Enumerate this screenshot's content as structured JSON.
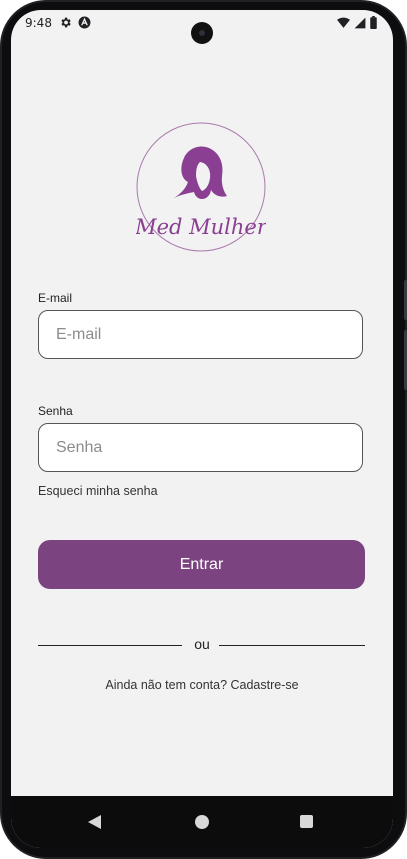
{
  "status_bar": {
    "time": "9:48",
    "left_icons": [
      "settings-gear-icon",
      "a-badge-icon"
    ],
    "right_icons": [
      "wifi-icon",
      "cellular-signal-icon",
      "battery-icon"
    ]
  },
  "logo": {
    "text": "Med Mulher",
    "color": "#8a3f92",
    "icon": "woman-silhouette-icon"
  },
  "form": {
    "email_label": "E-mail",
    "email_placeholder": "E-mail",
    "email_value": "",
    "password_label": "Senha",
    "password_placeholder": "Senha",
    "password_value": "",
    "forgot_password": "Esqueci minha senha",
    "submit_label": "Entrar",
    "divider_text": "ou",
    "signup_text": "Ainda não tem conta? Cadastre-se"
  },
  "colors": {
    "primary": "#7c4381",
    "background": "#f2f2f2",
    "field_border": "#555555"
  },
  "nav_bar": {
    "buttons": [
      "back-icon",
      "home-icon",
      "recents-icon"
    ]
  }
}
